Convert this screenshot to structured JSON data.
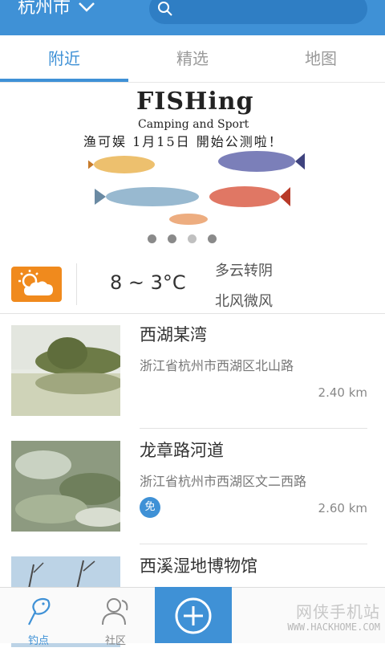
{
  "header": {
    "city": "杭州市",
    "search_placeholder": ""
  },
  "tabs": [
    {
      "label": "附近",
      "active": true
    },
    {
      "label": "精选",
      "active": false
    },
    {
      "label": "地图",
      "active": false
    }
  ],
  "banner": {
    "title": "FISHing",
    "subtitle": "Camping and Sport",
    "announcement": "渔可娱 1月15日 開始公测啦！",
    "dots": 4,
    "active_dot": 2
  },
  "weather": {
    "icon": "partly-cloudy-icon",
    "temperature": "8 ~ 3°C",
    "condition": "多云转阴",
    "wind": "北风微风"
  },
  "spots": [
    {
      "name": "西湖某湾",
      "address": "浙江省杭州市西湖区北山路",
      "distance": "2.40 km",
      "free": false
    },
    {
      "name": "龙章路河道",
      "address": "浙江省杭州市西湖区文二西路",
      "distance": "2.60 km",
      "free": true,
      "free_label": "免"
    },
    {
      "name": "西溪湿地博物馆",
      "address": "",
      "distance": "",
      "free": false
    }
  ],
  "bottom_nav": [
    {
      "label": "钓点",
      "icon": "fish-icon",
      "active": true
    },
    {
      "label": "社区",
      "icon": "people-icon",
      "active": false
    },
    {
      "label": "",
      "icon": "add-icon",
      "active": false
    },
    {
      "label": "",
      "icon": "",
      "active": false
    },
    {
      "label": "",
      "icon": "",
      "active": false
    }
  ],
  "watermark": {
    "text": "网侠手机站",
    "url": "WWW.HACKHOME.COM"
  },
  "colors": {
    "accent": "#3f91d6",
    "weather_orange": "#f08a1d"
  }
}
